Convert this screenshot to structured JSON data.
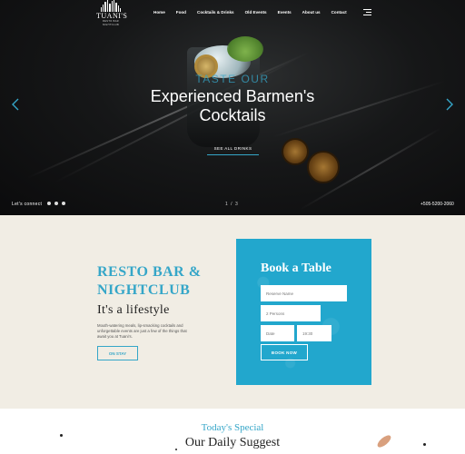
{
  "brand": {
    "name": "TUANI'S",
    "sub": "RESTO BAR NIGHTCLUB"
  },
  "nav": {
    "items": [
      "Home",
      "Food",
      "Cocktails & Drinks",
      "Old Events",
      "Events",
      "About us",
      "Contact"
    ]
  },
  "hero": {
    "kicker": "TASTE OUR",
    "title_line1": "Experienced Barmen's",
    "title_line2": "Cocktails",
    "button": "SEE ALL DRINKS",
    "lets_connect": "Let's connect",
    "pager": "1 / 3",
    "phone": "+505-5200-2060"
  },
  "about": {
    "title_line1": "RESTO BAR &",
    "title_line2": "NIGHTCLUB",
    "subtitle": "It's a lifestyle",
    "text": "Mouth-watering meals, lip-smacking cocktails and unforgettable events are just a few of the things that await you at Tuani's.",
    "button": "ON STAY"
  },
  "booking": {
    "title": "Book a Table",
    "name_placeholder": "Reserve Name",
    "people_value": "2 Persons",
    "date_placeholder": "Date",
    "time_value": "19:30",
    "button": "BOOK NOW"
  },
  "special": {
    "kicker": "Today's Special",
    "title": "Our Daily Suggest"
  },
  "colors": {
    "accent": "#22a7cd",
    "background": "#f1ede4"
  }
}
